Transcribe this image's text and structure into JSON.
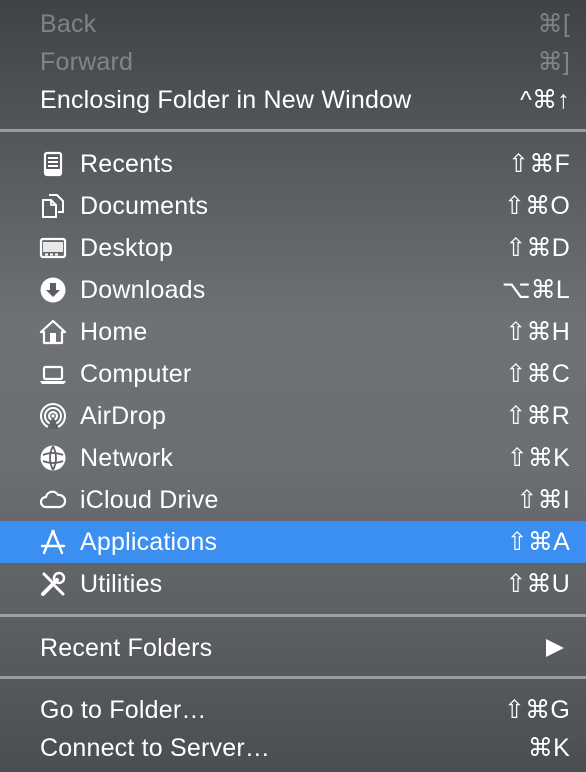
{
  "history": [
    {
      "label": "Back",
      "shortcut": "⌘[",
      "disabled": true
    },
    {
      "label": "Forward",
      "shortcut": "⌘]",
      "disabled": true
    },
    {
      "label": "Enclosing Folder in New Window",
      "shortcut": "^⌘↑",
      "disabled": false
    }
  ],
  "places": [
    {
      "label": "Recents",
      "shortcut": "⇧⌘F",
      "icon": "recents-icon"
    },
    {
      "label": "Documents",
      "shortcut": "⇧⌘O",
      "icon": "documents-icon"
    },
    {
      "label": "Desktop",
      "shortcut": "⇧⌘D",
      "icon": "desktop-icon"
    },
    {
      "label": "Downloads",
      "shortcut": "⌥⌘L",
      "icon": "downloads-icon"
    },
    {
      "label": "Home",
      "shortcut": "⇧⌘H",
      "icon": "home-icon"
    },
    {
      "label": "Computer",
      "shortcut": "⇧⌘C",
      "icon": "computer-icon"
    },
    {
      "label": "AirDrop",
      "shortcut": "⇧⌘R",
      "icon": "airdrop-icon"
    },
    {
      "label": "Network",
      "shortcut": "⇧⌘K",
      "icon": "network-icon"
    },
    {
      "label": "iCloud Drive",
      "shortcut": "⇧⌘I",
      "icon": "icloud-icon"
    },
    {
      "label": "Applications",
      "shortcut": "⇧⌘A",
      "icon": "applications-icon",
      "selected": true
    },
    {
      "label": "Utilities",
      "shortcut": "⇧⌘U",
      "icon": "utilities-icon"
    }
  ],
  "recent": {
    "label": "Recent Folders",
    "submenu_icon": "triangle-right-icon"
  },
  "goto": [
    {
      "label": "Go to Folder…",
      "shortcut": "⇧⌘G"
    },
    {
      "label": "Connect to Server…",
      "shortcut": "⌘K"
    }
  ],
  "colors": {
    "highlight": "#3b8ff0",
    "text": "#ffffff",
    "disabled_text": "rgba(255,255,255,0.32)"
  }
}
